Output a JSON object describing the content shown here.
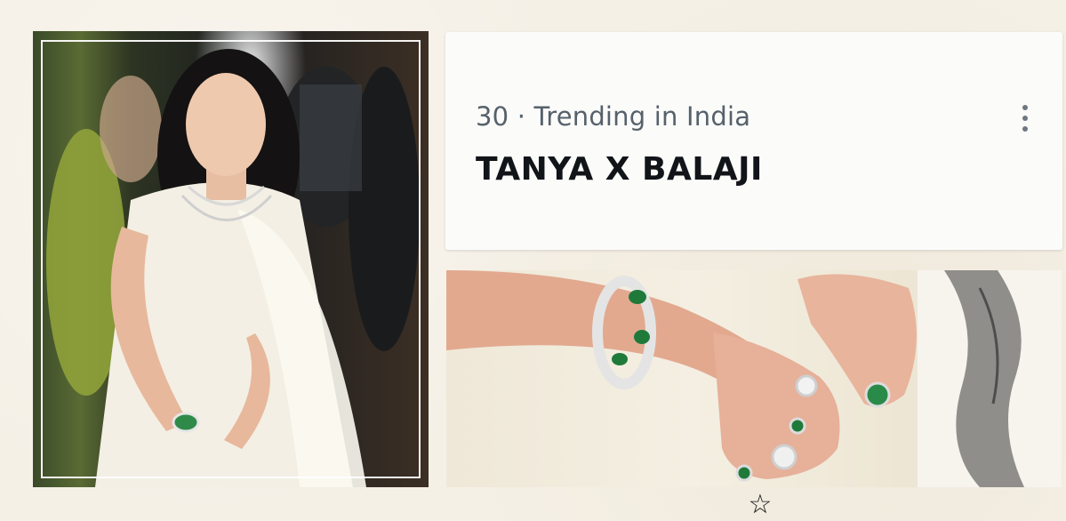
{
  "trending": {
    "meta": "30 · Trending in India",
    "title": "TANYA X BALAJI",
    "more_icon": "more-vertical-icon"
  },
  "images": {
    "left": "photo-portrait",
    "right": "photo-hands-jewelry"
  },
  "footer": {
    "star_glyph": "☆"
  },
  "colors": {
    "background": "#f5f0e6",
    "card": "#fbfbfa",
    "meta_text": "#56616b",
    "title_text": "#111418"
  }
}
